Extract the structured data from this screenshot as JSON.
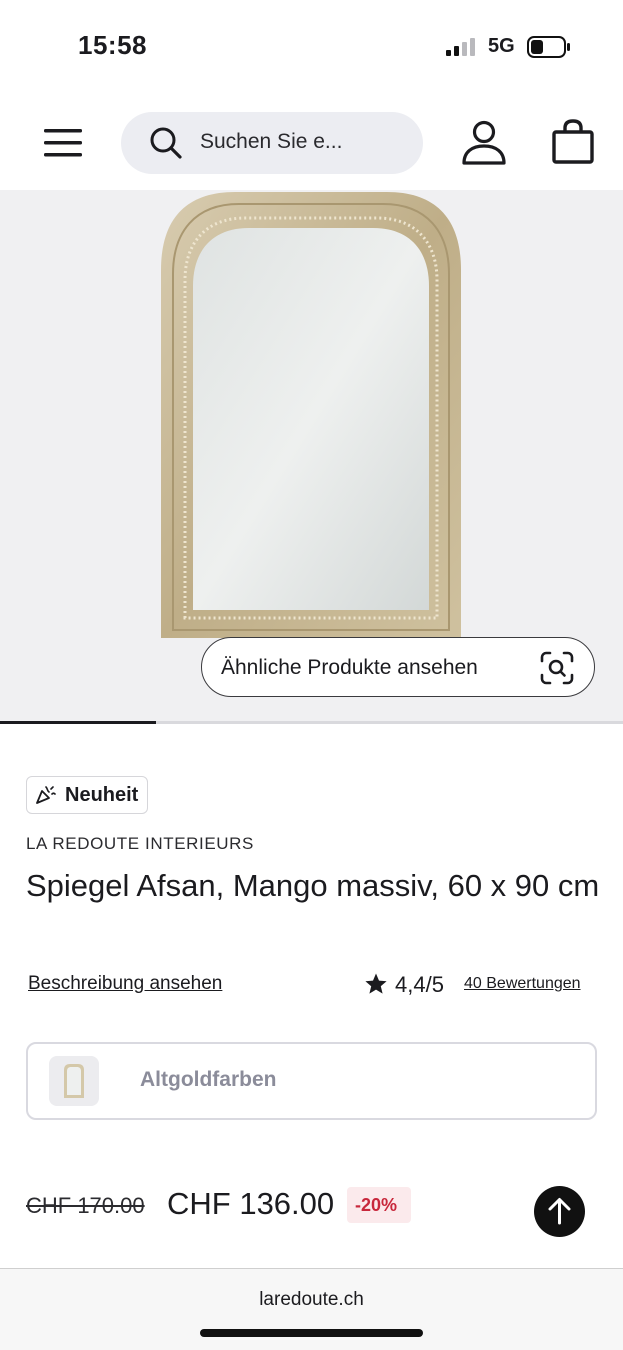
{
  "status_bar": {
    "time": "15:58",
    "network": "5G"
  },
  "header": {
    "search_placeholder": "Suchen Sie e..."
  },
  "gallery": {
    "similar_button_label": "Ähnliche Produkte ansehen",
    "progress": 0.25
  },
  "product": {
    "badge": "Neuheit",
    "brand": "LA REDOUTE INTERIEURS",
    "title": "Spiegel Afsan, Mango massiv, 60 x 90 cm",
    "description_link": "Beschreibung ansehen",
    "rating": "4,4/5",
    "reviews_link": "40 Bewertungen",
    "variant_label": "Altgoldfarben",
    "old_price": "CHF 170.00",
    "new_price": "CHF 136.00",
    "discount": "-20%"
  },
  "browser": {
    "url": "laredoute.ch"
  },
  "icons": [
    "menu-icon",
    "search-icon",
    "user-icon",
    "bag-icon",
    "visual-search-icon",
    "party-icon",
    "star-icon",
    "arrow-up-icon"
  ]
}
